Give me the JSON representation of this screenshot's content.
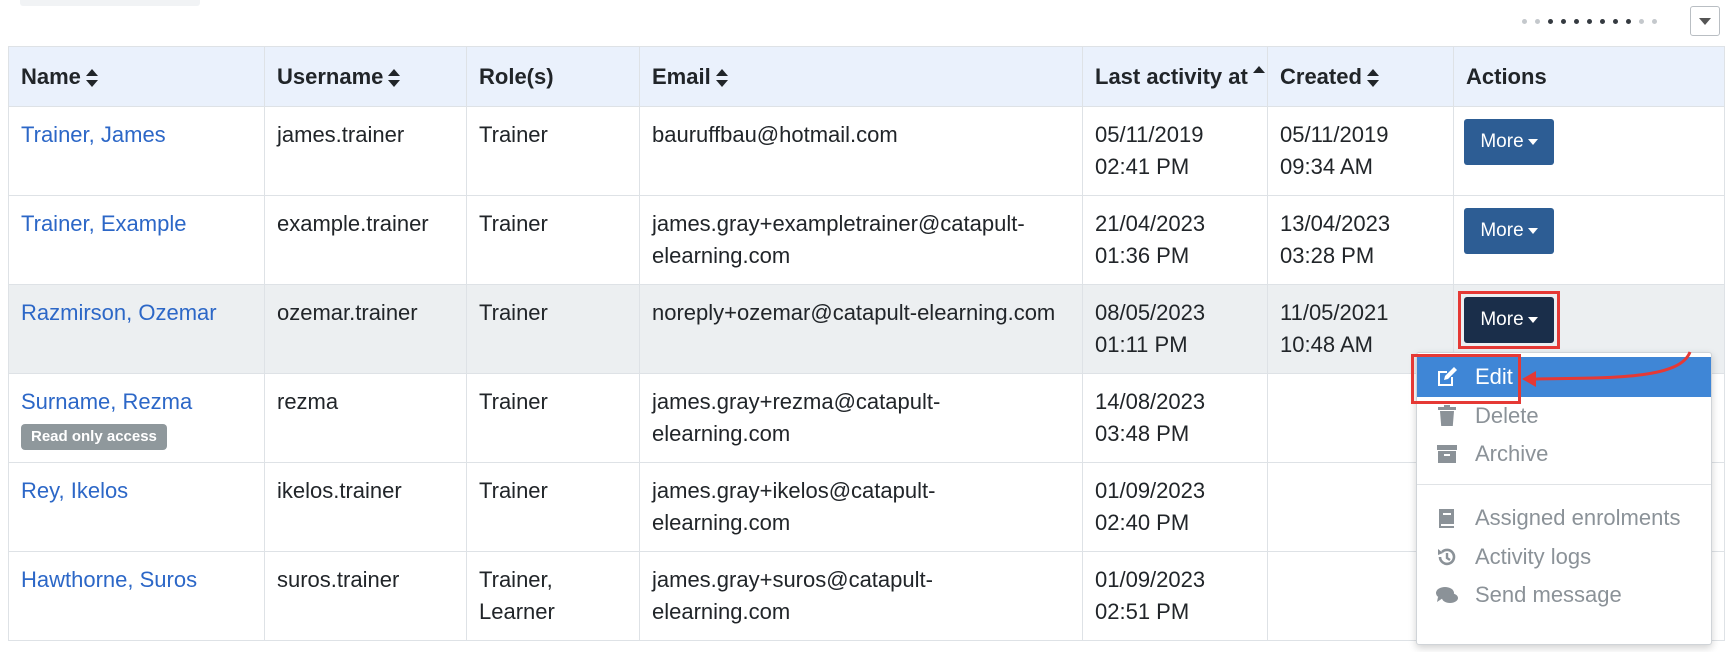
{
  "columns": [
    {
      "label": "Name",
      "sort": "both"
    },
    {
      "label": "Username",
      "sort": "both"
    },
    {
      "label": "Role(s)",
      "sort": "none"
    },
    {
      "label": "Email",
      "sort": "both"
    },
    {
      "label": "Last activity at",
      "sort": "asc"
    },
    {
      "label": "Created",
      "sort": "both"
    },
    {
      "label": "Actions",
      "sort": "none"
    }
  ],
  "rows": [
    {
      "name": "Trainer, James",
      "username": "james.trainer",
      "roles": "Trainer",
      "email": "bauruffbau@hotmail.com",
      "last_activity": [
        "05/11/2019",
        "02:41 PM"
      ],
      "created": [
        "05/11/2019",
        "09:34 AM"
      ],
      "badge": "",
      "more_label": "More"
    },
    {
      "name": "Trainer, Example",
      "username": "example.trainer",
      "roles": "Trainer",
      "email": "james.gray+exampletrainer@catapult-elearning.com",
      "last_activity": [
        "21/04/2023",
        "01:36 PM"
      ],
      "created": [
        "13/04/2023",
        "03:28 PM"
      ],
      "badge": "",
      "more_label": "More"
    },
    {
      "name": "Razmirson, Ozemar",
      "username": "ozemar.trainer",
      "roles": "Trainer",
      "email": "noreply+ozemar@catapult-elearning.com",
      "last_activity": [
        "08/05/2023",
        "01:11 PM"
      ],
      "created": [
        "11/05/2021",
        "10:48 AM"
      ],
      "badge": "",
      "more_label": "More"
    },
    {
      "name": "Surname, Rezma",
      "username": "rezma",
      "roles": "Trainer",
      "email": "james.gray+rezma@catapult-elearning.com",
      "last_activity": [
        "14/08/2023",
        "03:48 PM"
      ],
      "created": [
        "",
        ""
      ],
      "badge": "Read only access",
      "more_label": ""
    },
    {
      "name": "Rey, Ikelos",
      "username": "ikelos.trainer",
      "roles": "Trainer",
      "email": "james.gray+ikelos@catapult-elearning.com",
      "last_activity": [
        "01/09/2023",
        "02:40 PM"
      ],
      "created": [
        "",
        ""
      ],
      "badge": "",
      "more_label": ""
    },
    {
      "name": "Hawthorne, Suros",
      "username": "suros.trainer",
      "roles": "Trainer, Learner",
      "email": "james.gray+suros@catapult-elearning.com",
      "last_activity": [
        "01/09/2023",
        "02:51 PM"
      ],
      "created": [
        "",
        ""
      ],
      "badge": "",
      "more_label": ""
    }
  ],
  "dropdown": {
    "items": [
      {
        "label": "Edit",
        "icon": "edit-icon",
        "active": true
      },
      {
        "label": "Delete",
        "icon": "trash-icon",
        "active": false
      },
      {
        "label": "Archive",
        "icon": "archive-icon",
        "active": false
      },
      {
        "label": "Assigned enrolments",
        "icon": "book-icon",
        "active": false
      },
      {
        "label": "Activity logs",
        "icon": "history-icon",
        "active": false
      },
      {
        "label": "Send message",
        "icon": "comments-icon",
        "active": false
      }
    ]
  },
  "colors": {
    "header_bg": "#eaf1fc",
    "link": "#2c67c7",
    "button": "#2d5d94",
    "button_active": "#1a2e4a",
    "menu_active": "#3f86d6",
    "annotation": "#e53935",
    "badge": "#8f989c",
    "row_highlight": "#eceff1"
  }
}
